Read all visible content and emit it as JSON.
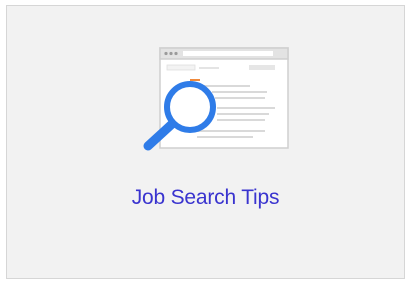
{
  "card": {
    "title": "Job Search Tips"
  },
  "illustration": {
    "icon": "magnifier-over-browser-window-icon"
  },
  "colors": {
    "card_background": "#f2f2f2",
    "card_border": "#d6d6d6",
    "title_text": "#3a34cf",
    "magnifier_blue": "#2f7ce8",
    "window_frame": "#cfcfcf",
    "accent_line": "#f08a3c"
  }
}
